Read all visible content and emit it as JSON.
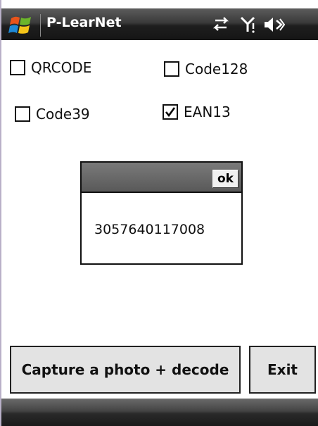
{
  "titlebar": {
    "app_title": "P-LearNet",
    "icons": [
      "windows-start-icon",
      "connectivity-icon",
      "signal-icon",
      "speaker-icon"
    ]
  },
  "options": {
    "qrcode": {
      "label": "QRCODE",
      "checked": false
    },
    "code128": {
      "label": "Code128",
      "checked": false
    },
    "code39": {
      "label": "Code39",
      "checked": false
    },
    "ean13": {
      "label": "EAN13",
      "checked": true
    }
  },
  "dialog": {
    "ok_label": "ok",
    "result": "3057640117008"
  },
  "buttons": {
    "capture_label": "Capture a photo + decode",
    "exit_label": "Exit"
  },
  "colors": {
    "titlebar": "#1e1e1e",
    "button_face": "#e3e3e3",
    "dialog_header": "#666666"
  }
}
